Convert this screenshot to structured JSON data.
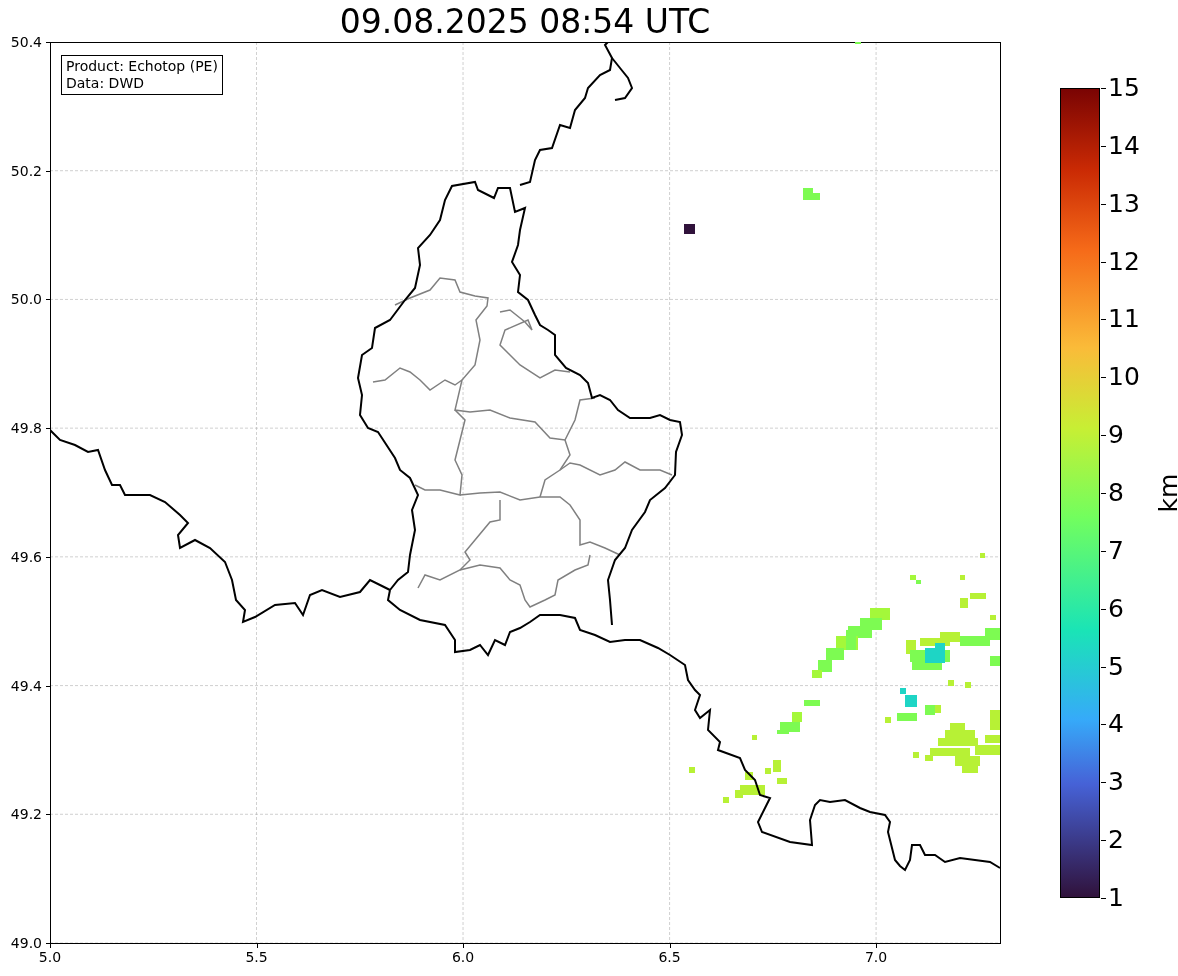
{
  "title": "09.08.2025 08:54 UTC",
  "legend": [
    "Product: Echotop (PE)",
    "Data: DWD"
  ],
  "x_axis": {
    "ticks": [
      "5.0",
      "5.5",
      "6.0",
      "6.5",
      "7.0"
    ]
  },
  "y_axis": {
    "ticks": [
      "50.4",
      "50.2",
      "50.0",
      "49.8",
      "49.6",
      "49.4",
      "49.2",
      "49.0"
    ]
  },
  "colorbar": {
    "label": "km",
    "ticks": [
      "15",
      "14",
      "13",
      "12",
      "11",
      "10",
      "9",
      "8",
      "7",
      "6",
      "5",
      "4",
      "3",
      "2",
      "1"
    ]
  }
}
